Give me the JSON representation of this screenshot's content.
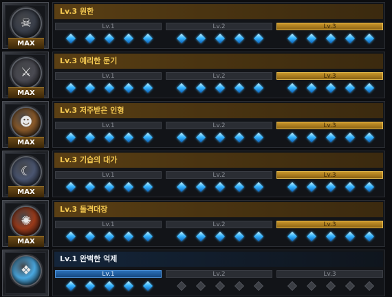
{
  "badge_text": "MAX",
  "tier_labels": [
    "Lv.1",
    "Lv.2",
    "Lv.3"
  ],
  "rows": [
    {
      "title": "Lv.3 원한",
      "level": 3,
      "max": true,
      "orb_color": "#3a3f4a",
      "orb_glyph": "☠"
    },
    {
      "title": "Lv.3 예리한 둔기",
      "level": 3,
      "max": true,
      "orb_color": "#4a4a52",
      "orb_glyph": "⚔"
    },
    {
      "title": "Lv.3 저주받은 인형",
      "level": 3,
      "max": true,
      "orb_color": "#8a5a2a",
      "orb_glyph": "☻"
    },
    {
      "title": "Lv.3 기습의 대가",
      "level": 3,
      "max": true,
      "orb_color": "#4a5570",
      "orb_glyph": "☾"
    },
    {
      "title": "Lv.3 돌격대장",
      "level": 3,
      "max": true,
      "orb_color": "#9a3a1a",
      "orb_glyph": "✺"
    },
    {
      "title": "Lv.1 완벽한 억제",
      "level": 1,
      "max": false,
      "orb_color": "#4aa8e0",
      "orb_glyph": "❖"
    }
  ],
  "colors": {
    "gold_active": "#c9962a",
    "blue_active": "#2a6fb8",
    "gem": "#38b6ff"
  }
}
